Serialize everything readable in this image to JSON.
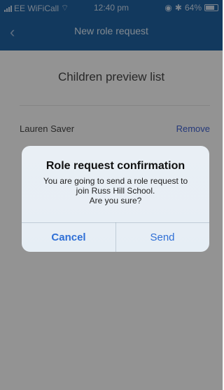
{
  "status_bar": {
    "carrier": "EE WiFiCall",
    "time": "12:40 pm",
    "battery": "64%"
  },
  "nav": {
    "title": "New role request"
  },
  "content": {
    "section_title": "Children preview list",
    "children": [
      {
        "name": "Lauren Saver",
        "action": "Remove"
      }
    ]
  },
  "dialog": {
    "title": "Role request confirmation",
    "message_line1": "You are going to send a role request to",
    "message_line2": "join Russ Hill School.",
    "message_line3": "Are you sure?",
    "cancel_label": "Cancel",
    "send_label": "Send"
  },
  "colors": {
    "header_bg": "#1f5f9d",
    "link": "#3e5fcc",
    "dialog_button": "#2f6fd6"
  }
}
